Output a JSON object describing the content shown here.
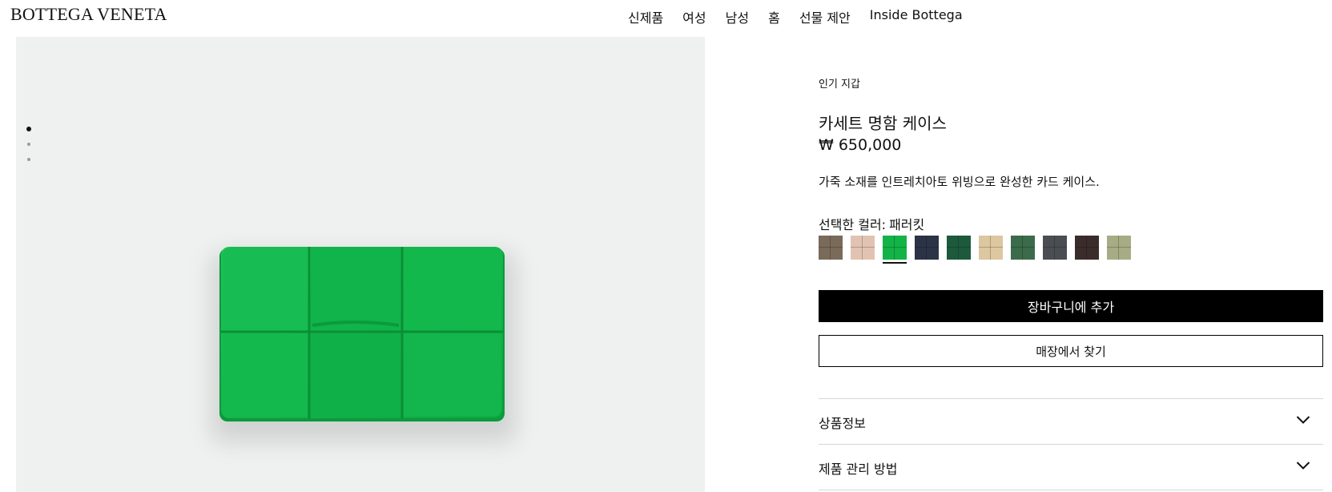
{
  "brand": {
    "logo": "BOTTEGA VENETA"
  },
  "nav": [
    {
      "label": "신제품"
    },
    {
      "label": "여성"
    },
    {
      "label": "남성"
    },
    {
      "label": "홈"
    },
    {
      "label": "선물 제안"
    },
    {
      "label": "Inside Bottega"
    }
  ],
  "gallery": {
    "total_images": 3,
    "active_index": 0
  },
  "product": {
    "category": "인기 지갑",
    "title": "카세트 명함 케이스",
    "price": "₩ 650,000",
    "description": "가죽 소재를 인트레치아토 위빙으로 완성한 카드 케이스.",
    "color_label": "선택한 컬러:",
    "selected_color": "패러킷",
    "swatches": [
      {
        "color": "#7a6a5a"
      },
      {
        "color": "#e2c3b2"
      },
      {
        "color": "#12b347",
        "selected": true
      },
      {
        "color": "#2b3446"
      },
      {
        "color": "#1d5a3c"
      },
      {
        "color": "#dcc7a0"
      },
      {
        "color": "#3b6b4a"
      },
      {
        "color": "#4a4d52"
      },
      {
        "color": "#3a2c2a"
      },
      {
        "color": "#a7ac84"
      }
    ]
  },
  "actions": {
    "add_to_cart": "장바구니에 추가",
    "find_in_store": "매장에서 찾기"
  },
  "accordion": [
    {
      "label": "상품정보"
    },
    {
      "label": "제품 관리 방법"
    }
  ],
  "colors": {
    "accent": "#000000",
    "product_green": "#12b347",
    "media_bg": "#eff1f0"
  }
}
